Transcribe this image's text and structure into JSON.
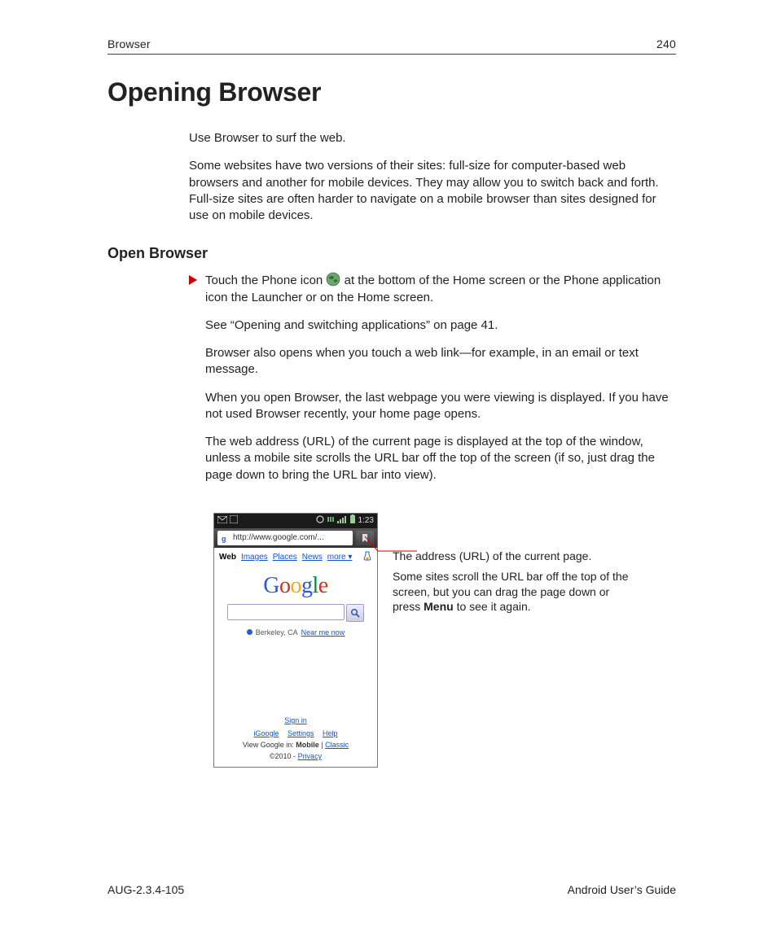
{
  "header": {
    "chapter": "Browser",
    "page_number": "240"
  },
  "title": "Opening Browser",
  "intro": {
    "p1": "Use Browser to surf the web.",
    "p2": "Some websites have two versions of their sites: full-size for computer-based web browsers and another for mobile devices. They may allow you to switch back and forth. Full-size sites are often harder to navigate on a mobile browser than sites designed for use on mobile devices."
  },
  "section": {
    "heading": "Open Browser",
    "bullet_pre": "Touch the Phone icon ",
    "bullet_post": " at the bottom of the Home screen or the Phone application icon the Launcher or on the Home screen.",
    "p_see": "See “Opening and switching applications” on page 41.",
    "p_also": "Browser also opens when you touch a web link—for example, in an email or text message.",
    "p_last": "When you open Browser, the last webpage you were viewing is displayed. If you have not used Browser recently, your home page opens.",
    "p_url": "The web address (URL) of the current page is displayed at the top of the window, unless a mobile site scrolls the URL bar off the top of the screen (if so, just drag the page down to bring the URL bar into view)."
  },
  "phone": {
    "time": "1:23",
    "url": "http://www.google.com/...",
    "tabs": {
      "web": "Web",
      "images": "Images",
      "places": "Places",
      "news": "News",
      "more": "more"
    },
    "location": {
      "city": "Berkeley, CA",
      "near_link": "Near me now"
    },
    "footer": {
      "signin": "Sign in",
      "igoogle": "iGoogle",
      "settings": "Settings",
      "help": "Help",
      "view_label": "View Google in: ",
      "mobile": "Mobile",
      "classic": "Classic",
      "copyright": "©2010 - ",
      "privacy": "Privacy"
    }
  },
  "annotations": {
    "a1": "The address (URL) of the current page.",
    "a2_pre": "Some sites scroll the URL bar off the top of the screen, but you can drag the page down or press ",
    "a2_bold": "Menu",
    "a2_post": " to see it again."
  },
  "footer": {
    "left": "AUG-2.3.4-105",
    "right": "Android User’s Guide"
  }
}
